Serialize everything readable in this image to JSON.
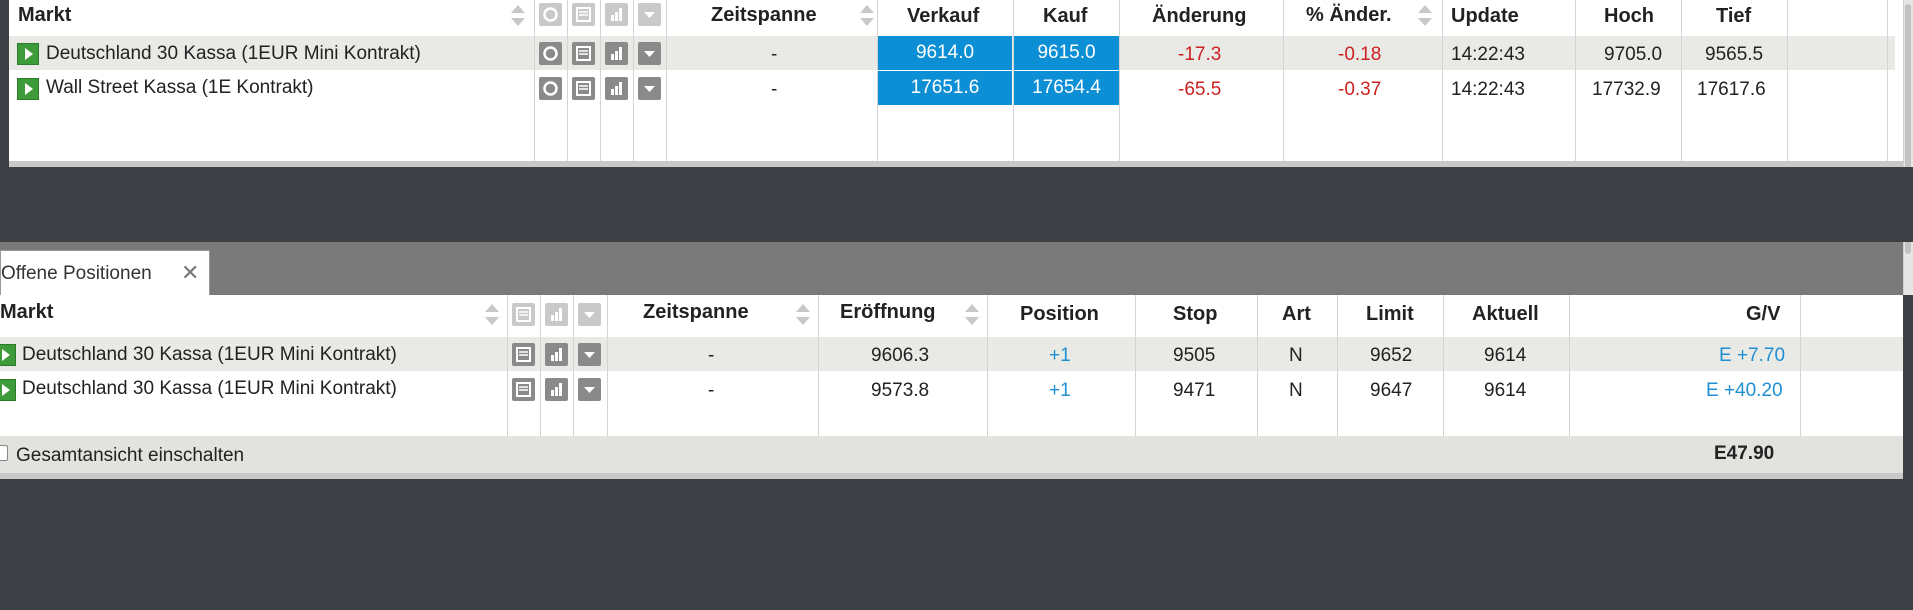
{
  "markets_table": {
    "headers": {
      "markt": "Markt",
      "zeitspanne": "Zeitspanne",
      "verkauf": "Verkauf",
      "kauf": "Kauf",
      "aenderung": "Änderung",
      "pct_aenderung": "% Änder.",
      "update": "Update",
      "hoch": "Hoch",
      "tief": "Tief"
    },
    "rows": [
      {
        "name": "Deutschland 30 Kassa (1EUR Mini Kontrakt)",
        "zeitspanne": "-",
        "verkauf": "9614.0",
        "kauf": "9615.0",
        "aenderung": "-17.3",
        "pct": "-0.18",
        "update": "14:22:43",
        "hoch": "9705.0",
        "tief": "9565.5"
      },
      {
        "name": "Wall Street Kassa (1E Kontrakt)",
        "zeitspanne": "-",
        "verkauf": "17651.6",
        "kauf": "17654.4",
        "aenderung": "-65.5",
        "pct": "-0.37",
        "update": "14:22:43",
        "hoch": "17732.9",
        "tief": "17617.6"
      }
    ]
  },
  "positions": {
    "tab_label": "Offene Positionen",
    "tab_close": "✕",
    "headers": {
      "markt": "Markt",
      "zeitspanne": "Zeitspanne",
      "eroeffnung": "Eröffnung",
      "position": "Position",
      "stop": "Stop",
      "art": "Art",
      "limit": "Limit",
      "aktuell": "Aktuell",
      "gv": "G/V"
    },
    "rows": [
      {
        "name": "Deutschland 30 Kassa (1EUR Mini Kontrakt)",
        "zeitspanne": "-",
        "eroeffnung": "9606.3",
        "position": "+1",
        "stop": "9505",
        "art": "N",
        "limit": "9652",
        "aktuell": "9614",
        "gv": "E +7.70"
      },
      {
        "name": "Deutschland 30 Kassa (1EUR Mini Kontrakt)",
        "zeitspanne": "-",
        "eroeffnung": "9573.8",
        "position": "+1",
        "stop": "9471",
        "art": "N",
        "limit": "9647",
        "aktuell": "9614",
        "gv": "E +40.20"
      }
    ],
    "footer": {
      "toggle_label": "Gesamtansicht einschalten",
      "total": "E47.90"
    }
  },
  "colors": {
    "price_cell": "#0d8fd6",
    "negative": "#cc2222",
    "positive_link": "#1f8fd4",
    "play_button": "#3e9b3a"
  },
  "icons": [
    "play-icon",
    "refresh-icon",
    "document-icon",
    "chart-icon",
    "dropdown-icon",
    "sort-icon",
    "close-icon"
  ]
}
